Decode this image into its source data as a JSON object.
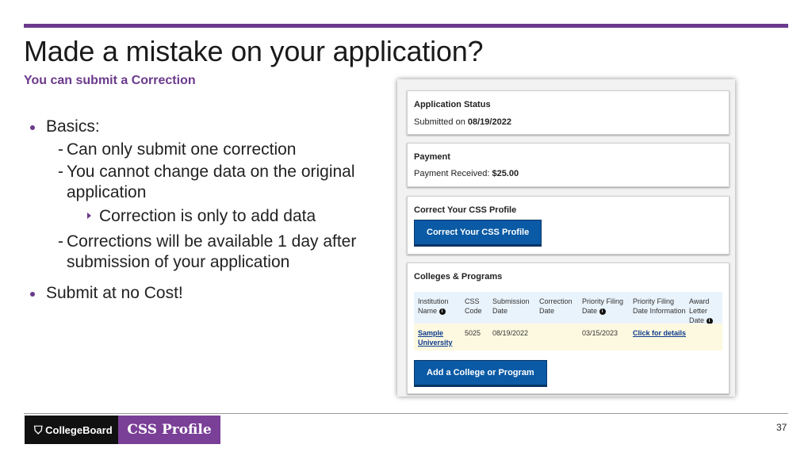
{
  "slide": {
    "title": "Made a mistake on your application?",
    "subtitle": "You can submit a Correction",
    "page_number": "37",
    "accent_color": "#6b3a8c"
  },
  "bullets": {
    "basics": "Basics:",
    "sub1": "Can only submit one correction",
    "sub2": "You cannot change data on the original application",
    "sub2_child": "Correction is only to add data",
    "sub3": "Corrections will be available 1 day after submission of your application",
    "no_cost": "Submit at no Cost!"
  },
  "app_status": {
    "heading": "Application Status",
    "label": "Submitted on",
    "date": "08/19/2022"
  },
  "payment": {
    "heading": "Payment",
    "label": "Payment Received:",
    "amount": "$25.00"
  },
  "correct": {
    "heading": "Correct Your CSS Profile",
    "button": "Correct Your CSS Profile",
    "button_color": "#0a5aa5"
  },
  "colleges": {
    "heading": "Colleges & Programs",
    "columns": {
      "institution": "Institution Name",
      "code": "CSS Code",
      "submission": "Submission Date",
      "correction": "Correction Date",
      "priority": "Priority Filing Date",
      "priority_info": "Priority Filing Date Information",
      "award": "Award Letter Date"
    },
    "rows": [
      {
        "institution": "Sample University",
        "code": "5025",
        "submission": "08/19/2022",
        "correction": "",
        "priority": "03/15/2023",
        "priority_info": "Click for details",
        "award": ""
      }
    ],
    "add_button": "Add a College or Program"
  },
  "footer": {
    "collegeboard": "CollegeBoard",
    "css_profile": "CSS Profile"
  }
}
